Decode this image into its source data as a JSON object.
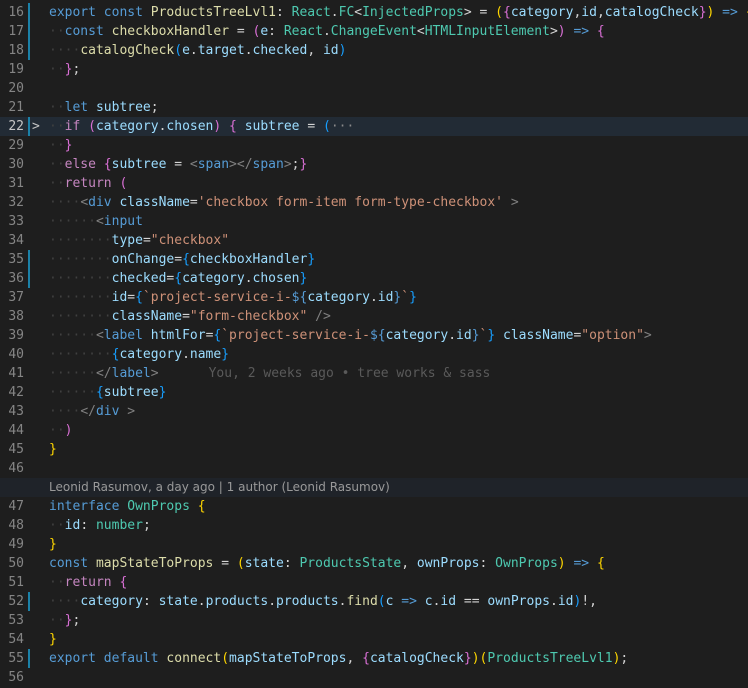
{
  "editor": {
    "codelens": "Leonid Rasumov, a day ago | 1 author (Leonid Rasumov)",
    "inline_blame": "You, 2 weeks ago • tree works & sass",
    "lines": [
      {
        "num": "16",
        "mod": true,
        "tokens": [
          [
            "kw",
            "export"
          ],
          [
            "pun",
            " "
          ],
          [
            "kw",
            "const"
          ],
          [
            "pun",
            " "
          ],
          [
            "fn",
            "ProductsTreeLvl1"
          ],
          [
            "pun",
            ": "
          ],
          [
            "ty",
            "React"
          ],
          [
            "pun",
            "."
          ],
          [
            "ty",
            "FC"
          ],
          [
            "pun",
            "<"
          ],
          [
            "ty",
            "InjectedProps"
          ],
          [
            "pun",
            "> = "
          ],
          [
            "br2",
            "("
          ],
          [
            "br",
            "{"
          ],
          [
            "var",
            "category"
          ],
          [
            "pun",
            ","
          ],
          [
            "var",
            "id"
          ],
          [
            "pun",
            ","
          ],
          [
            "var",
            "catalogCheck"
          ],
          [
            "br",
            "}"
          ],
          [
            "br2",
            ")"
          ],
          [
            "pun",
            " "
          ],
          [
            "kw",
            "=>"
          ],
          [
            "pun",
            " "
          ],
          [
            "br2",
            "{"
          ]
        ]
      },
      {
        "num": "17",
        "mod": true,
        "tokens": [
          [
            "ind",
            "··"
          ],
          [
            "kw",
            "const"
          ],
          [
            "pun",
            " "
          ],
          [
            "fn",
            "checkboxHandler"
          ],
          [
            "pun",
            " = "
          ],
          [
            "br",
            "("
          ],
          [
            "var",
            "e"
          ],
          [
            "pun",
            ": "
          ],
          [
            "ty",
            "React"
          ],
          [
            "pun",
            "."
          ],
          [
            "ty",
            "ChangeEvent"
          ],
          [
            "pun",
            "<"
          ],
          [
            "ty",
            "HTMLInputElement"
          ],
          [
            "pun",
            ">"
          ],
          [
            "br",
            ")"
          ],
          [
            "pun",
            " "
          ],
          [
            "kw",
            "=>"
          ],
          [
            "pun",
            " "
          ],
          [
            "br",
            "{"
          ]
        ]
      },
      {
        "num": "18",
        "mod": true,
        "tokens": [
          [
            "ind",
            "····"
          ],
          [
            "fn",
            "catalogCheck"
          ],
          [
            "br3",
            "("
          ],
          [
            "var",
            "e"
          ],
          [
            "pun",
            "."
          ],
          [
            "var",
            "target"
          ],
          [
            "pun",
            "."
          ],
          [
            "var",
            "checked"
          ],
          [
            "pun",
            ", "
          ],
          [
            "var",
            "id"
          ],
          [
            "br3",
            ")"
          ]
        ]
      },
      {
        "num": "19",
        "mod": false,
        "tokens": [
          [
            "ind",
            "··"
          ],
          [
            "br",
            "}"
          ],
          [
            "pun",
            ";"
          ]
        ]
      },
      {
        "num": "20",
        "mod": false,
        "tokens": []
      },
      {
        "num": "21",
        "mod": false,
        "tokens": [
          [
            "ind",
            "··"
          ],
          [
            "kw",
            "let"
          ],
          [
            "pun",
            " "
          ],
          [
            "var",
            "subtree"
          ],
          [
            "pun",
            ";"
          ]
        ]
      },
      {
        "num": "22",
        "mod": true,
        "fold": ">",
        "current": true,
        "tokens": [
          [
            "ind",
            "··"
          ],
          [
            "ctl",
            "if"
          ],
          [
            "pun",
            " "
          ],
          [
            "br",
            "("
          ],
          [
            "var",
            "category"
          ],
          [
            "pun",
            "."
          ],
          [
            "var",
            "chosen"
          ],
          [
            "br",
            ")"
          ],
          [
            "pun",
            " "
          ],
          [
            "br",
            "{"
          ],
          [
            "pun",
            " "
          ],
          [
            "var",
            "subtree"
          ],
          [
            "pun",
            " = "
          ],
          [
            "br3",
            "("
          ],
          [
            "fold-ellipsis",
            "···"
          ]
        ]
      },
      {
        "num": "29",
        "mod": false,
        "tokens": [
          [
            "ind",
            "··"
          ],
          [
            "br",
            "}"
          ]
        ]
      },
      {
        "num": "30",
        "mod": false,
        "tokens": [
          [
            "ind",
            "··"
          ],
          [
            "ctl",
            "else"
          ],
          [
            "pun",
            " "
          ],
          [
            "br",
            "{"
          ],
          [
            "var",
            "subtree"
          ],
          [
            "pun",
            " = "
          ],
          [
            "tag",
            "<"
          ],
          [
            "tn",
            "span"
          ],
          [
            "tag",
            "></"
          ],
          [
            "tn",
            "span"
          ],
          [
            "tag",
            ">"
          ],
          [
            "pun",
            ";"
          ],
          [
            "br",
            "}"
          ]
        ]
      },
      {
        "num": "31",
        "mod": false,
        "tokens": [
          [
            "ind",
            "··"
          ],
          [
            "ctl",
            "return"
          ],
          [
            "pun",
            " "
          ],
          [
            "br",
            "("
          ]
        ]
      },
      {
        "num": "32",
        "mod": false,
        "tokens": [
          [
            "ind",
            "····"
          ],
          [
            "tag",
            "<"
          ],
          [
            "tn",
            "div"
          ],
          [
            "pun",
            " "
          ],
          [
            "at",
            "className"
          ],
          [
            "pun",
            "="
          ],
          [
            "str",
            "'checkbox form-item form-type-checkbox'"
          ],
          [
            "pun",
            " "
          ],
          [
            "tag",
            ">"
          ]
        ]
      },
      {
        "num": "33",
        "mod": false,
        "tokens": [
          [
            "ind",
            "······"
          ],
          [
            "tag",
            "<"
          ],
          [
            "tn",
            "input"
          ]
        ]
      },
      {
        "num": "34",
        "mod": false,
        "tokens": [
          [
            "ind",
            "········"
          ],
          [
            "at",
            "type"
          ],
          [
            "pun",
            "="
          ],
          [
            "str",
            "\"checkbox\""
          ]
        ]
      },
      {
        "num": "35",
        "mod": true,
        "tokens": [
          [
            "ind",
            "········"
          ],
          [
            "at",
            "onChange"
          ],
          [
            "pun",
            "="
          ],
          [
            "br3",
            "{"
          ],
          [
            "var",
            "checkboxHandler"
          ],
          [
            "br3",
            "}"
          ]
        ]
      },
      {
        "num": "36",
        "mod": true,
        "tokens": [
          [
            "ind",
            "········"
          ],
          [
            "at",
            "checked"
          ],
          [
            "pun",
            "="
          ],
          [
            "br3",
            "{"
          ],
          [
            "var",
            "category"
          ],
          [
            "pun",
            "."
          ],
          [
            "var",
            "chosen"
          ],
          [
            "br3",
            "}"
          ]
        ]
      },
      {
        "num": "37",
        "mod": false,
        "tokens": [
          [
            "ind",
            "········"
          ],
          [
            "at",
            "id"
          ],
          [
            "pun",
            "="
          ],
          [
            "br3",
            "{"
          ],
          [
            "str",
            "`project-service-i-"
          ],
          [
            "kw",
            "${"
          ],
          [
            "var",
            "category"
          ],
          [
            "pun",
            "."
          ],
          [
            "var",
            "id"
          ],
          [
            "kw",
            "}"
          ],
          [
            "str",
            "`"
          ],
          [
            "br3",
            "}"
          ]
        ]
      },
      {
        "num": "38",
        "mod": false,
        "tokens": [
          [
            "ind",
            "········"
          ],
          [
            "at",
            "className"
          ],
          [
            "pun",
            "="
          ],
          [
            "str",
            "\"form-checkbox\""
          ],
          [
            "pun",
            " "
          ],
          [
            "tag",
            "/>"
          ]
        ]
      },
      {
        "num": "39",
        "mod": false,
        "tokens": [
          [
            "ind",
            "······"
          ],
          [
            "tag",
            "<"
          ],
          [
            "tn",
            "label"
          ],
          [
            "pun",
            " "
          ],
          [
            "at",
            "htmlFor"
          ],
          [
            "pun",
            "="
          ],
          [
            "br3",
            "{"
          ],
          [
            "str",
            "`project-service-i-"
          ],
          [
            "kw",
            "${"
          ],
          [
            "var",
            "category"
          ],
          [
            "pun",
            "."
          ],
          [
            "var",
            "id"
          ],
          [
            "kw",
            "}"
          ],
          [
            "str",
            "`"
          ],
          [
            "br3",
            "}"
          ],
          [
            "pun",
            " "
          ],
          [
            "at",
            "className"
          ],
          [
            "pun",
            "="
          ],
          [
            "str",
            "\"option\""
          ],
          [
            "tag",
            ">"
          ]
        ]
      },
      {
        "num": "40",
        "mod": false,
        "tokens": [
          [
            "ind",
            "········"
          ],
          [
            "br3",
            "{"
          ],
          [
            "var",
            "category"
          ],
          [
            "pun",
            "."
          ],
          [
            "var",
            "name"
          ],
          [
            "br3",
            "}"
          ]
        ]
      },
      {
        "num": "41",
        "mod": false,
        "blame": true,
        "tokens": [
          [
            "ind",
            "······"
          ],
          [
            "tag",
            "</"
          ],
          [
            "tn",
            "label"
          ],
          [
            "tag",
            ">"
          ]
        ]
      },
      {
        "num": "42",
        "mod": false,
        "tokens": [
          [
            "ind",
            "······"
          ],
          [
            "br3",
            "{"
          ],
          [
            "var",
            "subtree"
          ],
          [
            "br3",
            "}"
          ]
        ]
      },
      {
        "num": "43",
        "mod": false,
        "tokens": [
          [
            "ind",
            "····"
          ],
          [
            "tag",
            "</"
          ],
          [
            "tn",
            "div"
          ],
          [
            "pun",
            " "
          ],
          [
            "tag",
            ">"
          ]
        ]
      },
      {
        "num": "44",
        "mod": false,
        "tokens": [
          [
            "ind",
            "··"
          ],
          [
            "br",
            ")"
          ]
        ]
      },
      {
        "num": "45",
        "mod": false,
        "tokens": [
          [
            "br2",
            "}"
          ]
        ]
      },
      {
        "num": "46",
        "mod": false,
        "tokens": []
      },
      {
        "num": "",
        "mod": false,
        "codelens": true,
        "tokens": []
      },
      {
        "num": "47",
        "mod": false,
        "tokens": [
          [
            "kw",
            "interface"
          ],
          [
            "pun",
            " "
          ],
          [
            "ty",
            "OwnProps"
          ],
          [
            "pun",
            " "
          ],
          [
            "br2",
            "{"
          ]
        ]
      },
      {
        "num": "48",
        "mod": false,
        "tokens": [
          [
            "ind",
            "··"
          ],
          [
            "var",
            "id"
          ],
          [
            "pun",
            ": "
          ],
          [
            "ty",
            "number"
          ],
          [
            "pun",
            ";"
          ]
        ]
      },
      {
        "num": "49",
        "mod": false,
        "tokens": [
          [
            "br2",
            "}"
          ]
        ]
      },
      {
        "num": "50",
        "mod": false,
        "tokens": [
          [
            "kw",
            "const"
          ],
          [
            "pun",
            " "
          ],
          [
            "fn",
            "mapStateToProps"
          ],
          [
            "pun",
            " = "
          ],
          [
            "br2",
            "("
          ],
          [
            "var",
            "state"
          ],
          [
            "pun",
            ": "
          ],
          [
            "ty",
            "ProductsState"
          ],
          [
            "pun",
            ", "
          ],
          [
            "var",
            "ownProps"
          ],
          [
            "pun",
            ": "
          ],
          [
            "ty",
            "OwnProps"
          ],
          [
            "br2",
            ")"
          ],
          [
            "pun",
            " "
          ],
          [
            "kw",
            "=>"
          ],
          [
            "pun",
            " "
          ],
          [
            "br2",
            "{"
          ]
        ]
      },
      {
        "num": "51",
        "mod": false,
        "tokens": [
          [
            "ind",
            "··"
          ],
          [
            "ctl",
            "return"
          ],
          [
            "pun",
            " "
          ],
          [
            "br",
            "{"
          ]
        ]
      },
      {
        "num": "52",
        "mod": true,
        "tokens": [
          [
            "ind",
            "····"
          ],
          [
            "var",
            "category"
          ],
          [
            "pun",
            ": "
          ],
          [
            "var",
            "state"
          ],
          [
            "pun",
            "."
          ],
          [
            "var",
            "products"
          ],
          [
            "pun",
            "."
          ],
          [
            "var",
            "products"
          ],
          [
            "pun",
            "."
          ],
          [
            "fn",
            "find"
          ],
          [
            "br3",
            "("
          ],
          [
            "var",
            "c"
          ],
          [
            "pun",
            " "
          ],
          [
            "kw",
            "=>"
          ],
          [
            "pun",
            " "
          ],
          [
            "var",
            "c"
          ],
          [
            "pun",
            "."
          ],
          [
            "var",
            "id"
          ],
          [
            "pun",
            " == "
          ],
          [
            "var",
            "ownProps"
          ],
          [
            "pun",
            "."
          ],
          [
            "var",
            "id"
          ],
          [
            "br3",
            ")"
          ],
          [
            "pun",
            "!,"
          ]
        ]
      },
      {
        "num": "53",
        "mod": false,
        "tokens": [
          [
            "ind",
            "··"
          ],
          [
            "br",
            "}"
          ],
          [
            "pun",
            ";"
          ]
        ]
      },
      {
        "num": "54",
        "mod": false,
        "tokens": [
          [
            "br2",
            "}"
          ]
        ]
      },
      {
        "num": "55",
        "mod": true,
        "tokens": [
          [
            "kw",
            "export"
          ],
          [
            "pun",
            " "
          ],
          [
            "kw",
            "default"
          ],
          [
            "pun",
            " "
          ],
          [
            "fn",
            "connect"
          ],
          [
            "br2",
            "("
          ],
          [
            "var",
            "mapStateToProps"
          ],
          [
            "pun",
            ", "
          ],
          [
            "br",
            "{"
          ],
          [
            "var",
            "catalogCheck"
          ],
          [
            "br",
            "}"
          ],
          [
            "br2",
            ")"
          ],
          [
            "br2",
            "("
          ],
          [
            "ty",
            "ProductsTreeLvl1"
          ],
          [
            "br2",
            ")"
          ],
          [
            "pun",
            ";"
          ]
        ]
      },
      {
        "num": "56",
        "mod": false,
        "tokens": []
      }
    ]
  },
  "colors": {
    "background": "#1e1e1e",
    "line_highlight": "#222b35",
    "modified_bar": "#1b81a8"
  }
}
